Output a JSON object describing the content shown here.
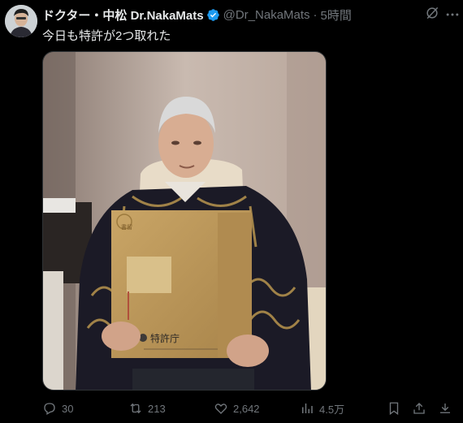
{
  "tweet": {
    "display_name": "ドクター・中松 Dr.NakaMats",
    "handle": "@Dr_NakaMats",
    "separator": "·",
    "time": "5時間",
    "text": "今日も特許が2つ取れた",
    "photo": {
      "folder_label": "特許庁",
      "stamp": "書留"
    }
  },
  "actions": {
    "replies": "30",
    "reposts": "213",
    "likes": "2,642",
    "views": "4.5万"
  },
  "colors": {
    "background": "#000000",
    "text": "#e7e9ea",
    "muted": "#71767b",
    "verified": "#1d9bf0"
  },
  "icons": [
    "verified-badge-icon",
    "grok-icon",
    "more-icon",
    "reply-icon",
    "repost-icon",
    "like-icon",
    "views-icon",
    "bookmark-icon",
    "share-icon",
    "download-icon"
  ]
}
